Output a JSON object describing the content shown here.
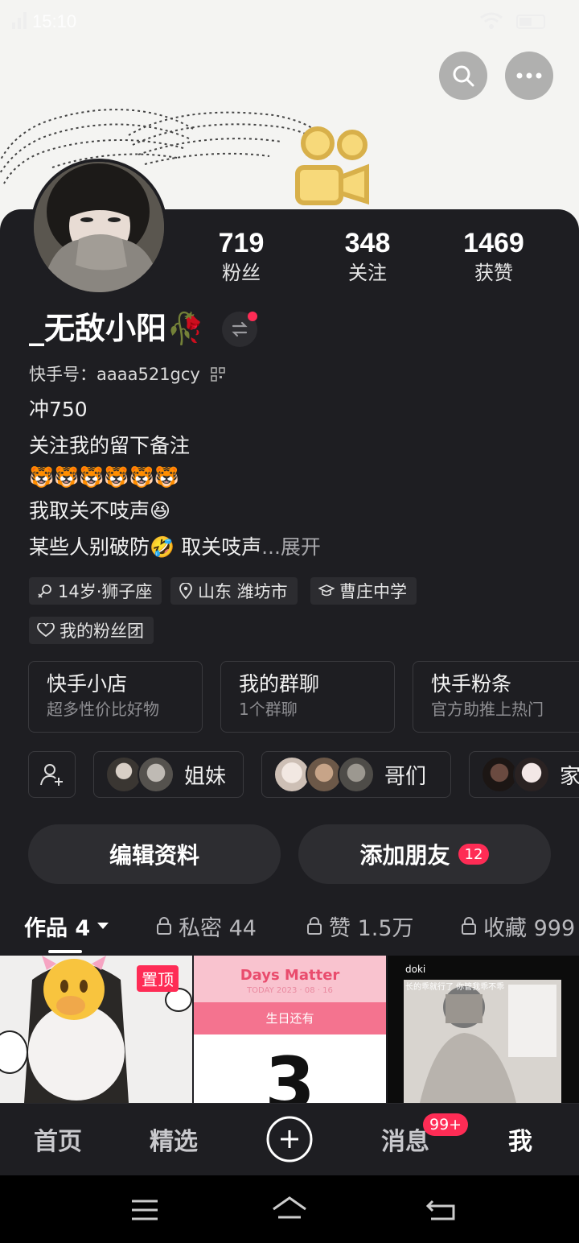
{
  "status_bar": {
    "time": "15:10",
    "battery": "48"
  },
  "profile": {
    "name": "_无敌小阳🥀",
    "kuaishou_id": "快手号：aaaa521gcy",
    "stats": [
      {
        "value": "719",
        "label": "粉丝"
      },
      {
        "value": "348",
        "label": "关注"
      },
      {
        "value": "1469",
        "label": "获赞"
      }
    ],
    "bio_lines": [
      "冲750",
      "关注我的留下备注",
      "🐯🐯🐯🐯🐯🐯",
      "我取关不吱声😆",
      "某些人别破防🤣 取关吱声"
    ],
    "bio_more": "...展开",
    "tags": [
      {
        "icon": "gender-icon",
        "label": "14岁·狮子座"
      },
      {
        "icon": "location-icon",
        "label": "山东 潍坊市"
      },
      {
        "icon": "school-icon",
        "label": "曹庄中学"
      },
      {
        "icon": "heart-icon",
        "label": "我的粉丝团"
      }
    ]
  },
  "feature_cards": [
    {
      "title": "快手小店",
      "subtitle": "超多性价比好物"
    },
    {
      "title": "我的群聊",
      "subtitle": "1个群聊"
    },
    {
      "title": "快手粉条",
      "subtitle": "官方助推上热门"
    }
  ],
  "groups": [
    {
      "label": "姐妹"
    },
    {
      "label": "哥们"
    },
    {
      "label": "家"
    }
  ],
  "buttons": {
    "edit_profile": "编辑资料",
    "add_friends": "添加朋友",
    "add_friends_badge": "12"
  },
  "tabs": [
    {
      "label": "作品 4"
    },
    {
      "label": "私密 44"
    },
    {
      "label": "赞 1.5万"
    },
    {
      "label": "收藏 999"
    }
  ],
  "grid": {
    "pinned_label": "置顶",
    "days_matter_title": "Days Matter",
    "days_matter_date": "TODAY 2023 · 08 · 16",
    "days_matter_sub": "生日还有",
    "days_matter_number": "3",
    "third_caption_user": "doki",
    "third_caption_text": "长的乖就行了 你管我乖不乖"
  },
  "bottom_nav": [
    {
      "label": "首页"
    },
    {
      "label": "精选"
    },
    {
      "label": "消息",
      "badge": "99+"
    },
    {
      "label": "我"
    }
  ],
  "colors": {
    "background": "#1e1e22",
    "accent": "#fe2c55",
    "card_border": "#3a3a3e"
  }
}
